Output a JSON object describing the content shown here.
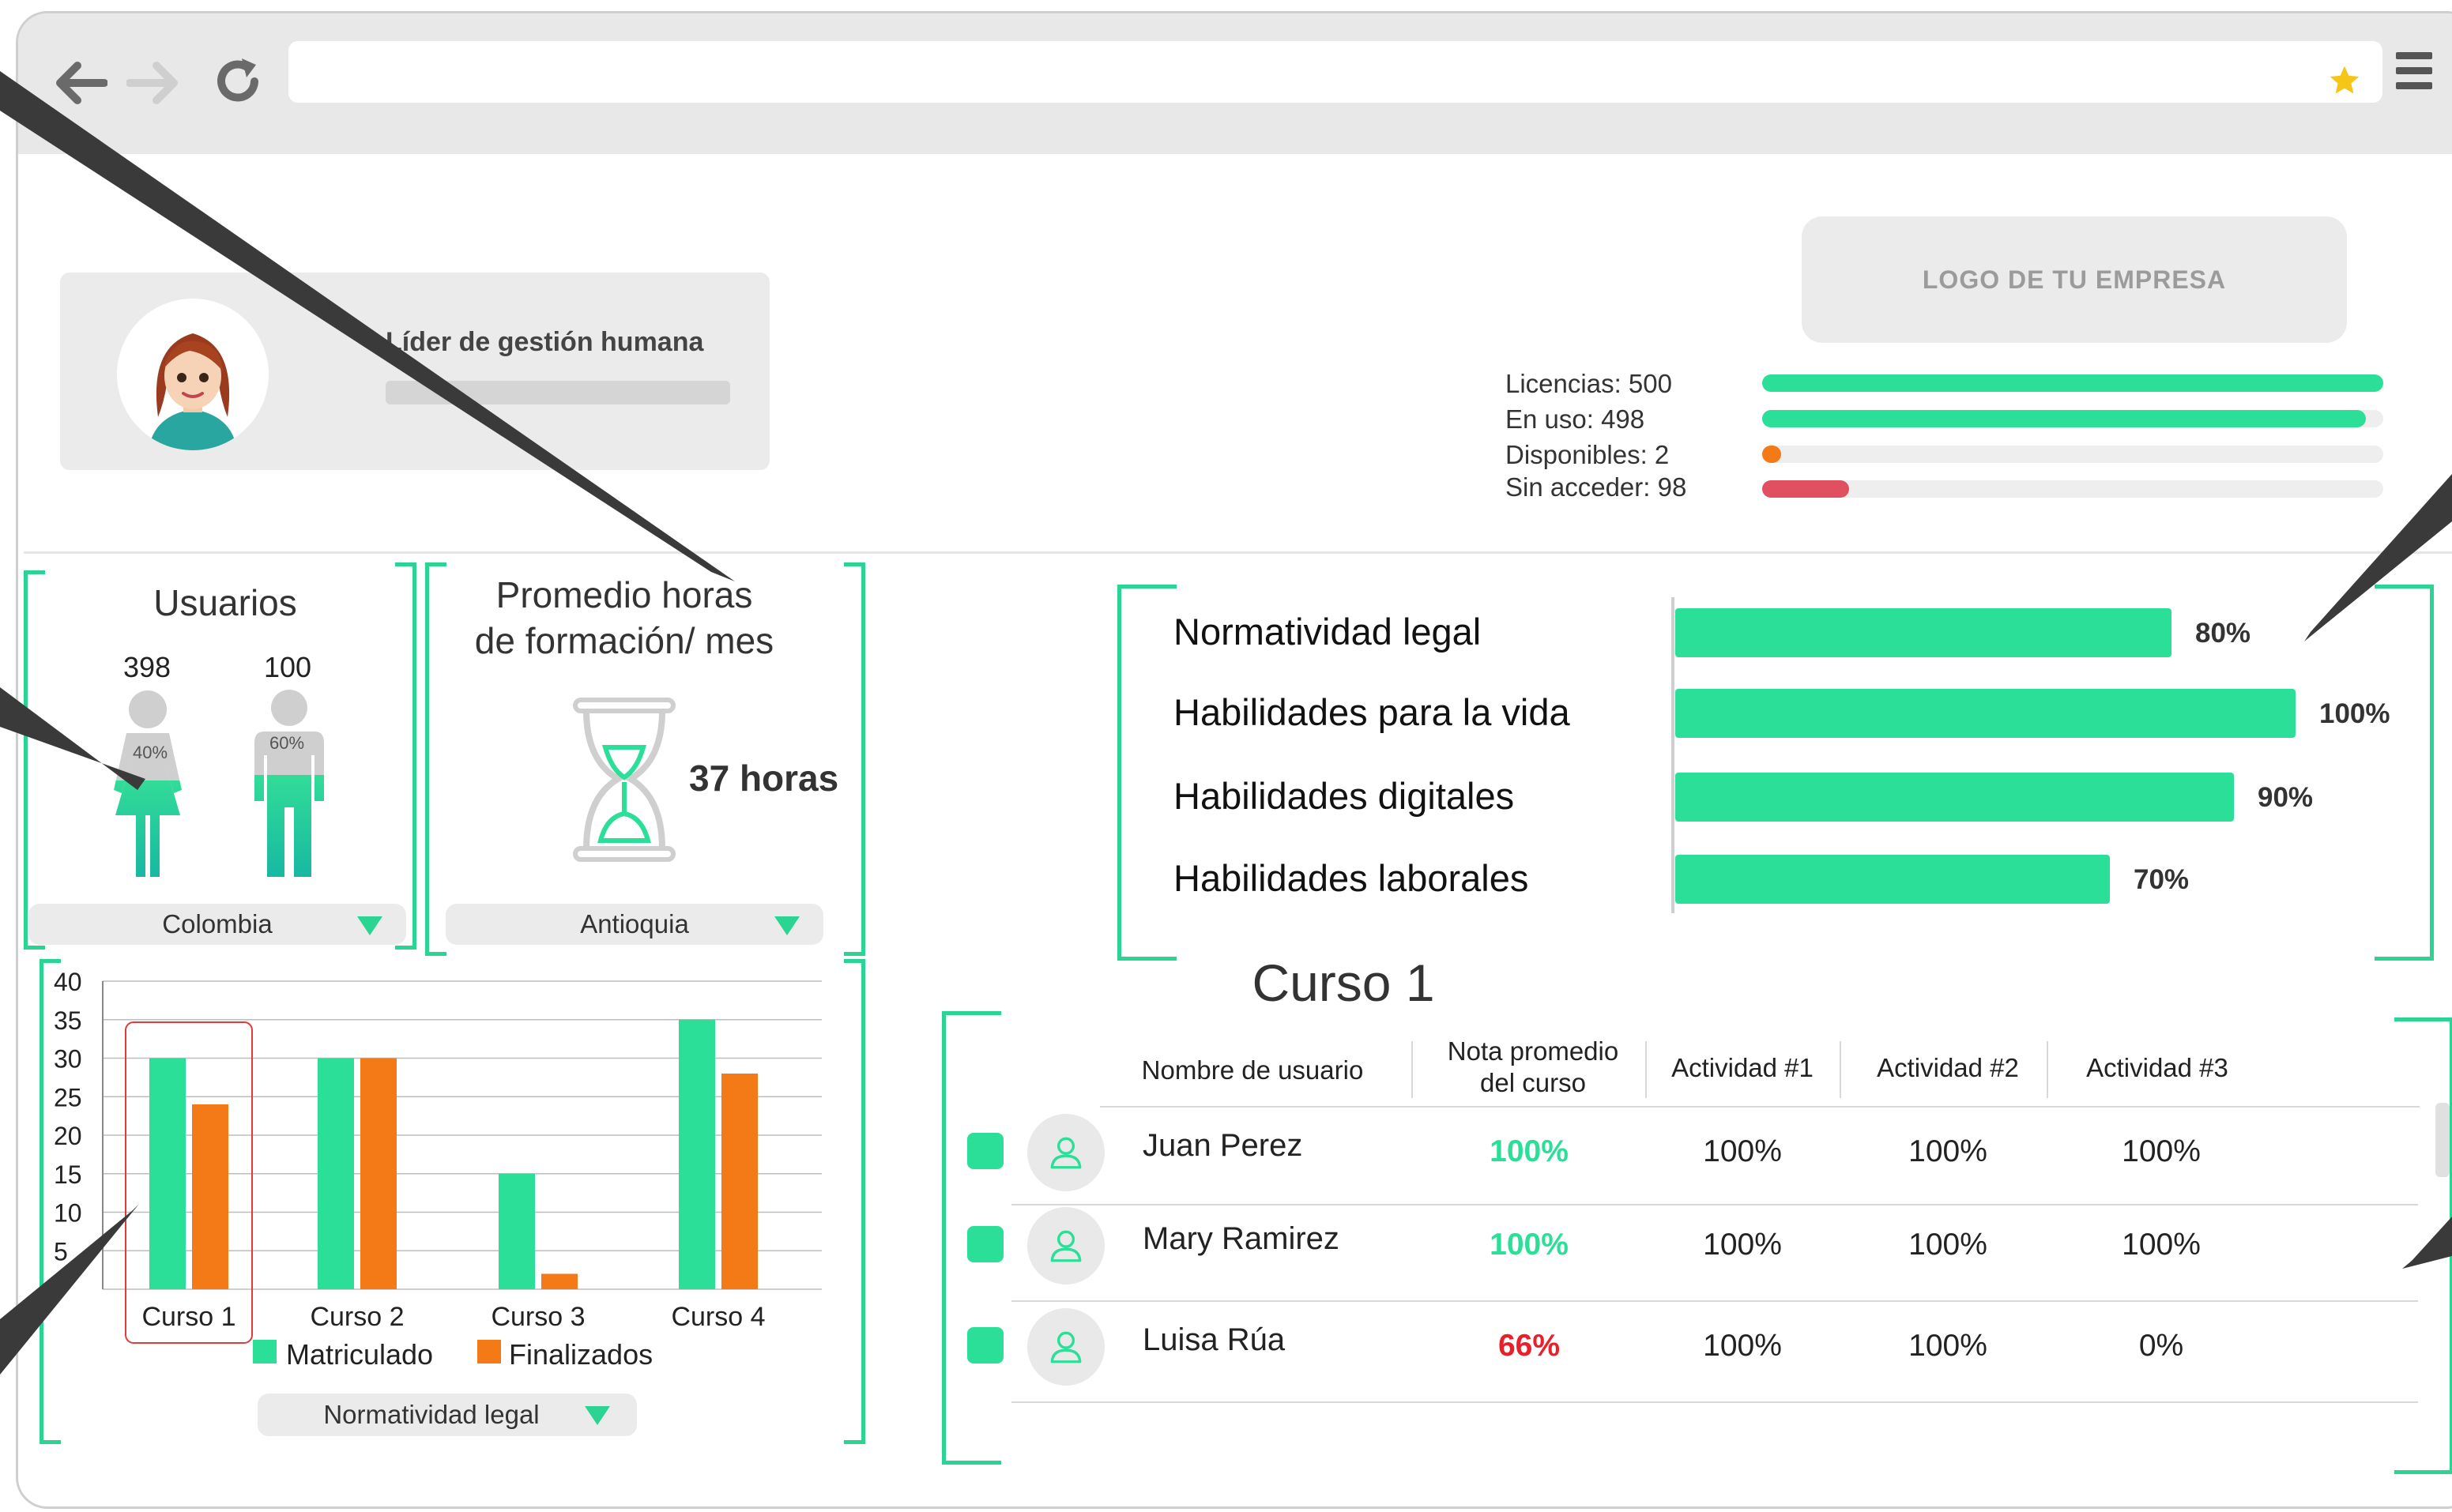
{
  "colors": {
    "accent_green": "#2cdf98",
    "bracket_green": "#2bd492",
    "orange": "#f47a17",
    "red": "#e05060",
    "dark_gray": "#3a3a3a"
  },
  "profile": {
    "role": "Líder de gestión humana",
    "avatar_icon": "woman-avatar-icon"
  },
  "logo": {
    "label": "LOGO DE TU EMPRESA"
  },
  "licenses": [
    {
      "label": "Licencias: 500",
      "fill": 1.0,
      "color": "#2cdf98"
    },
    {
      "label": "En uso: 498",
      "fill": 0.972,
      "color": "#2cdf98"
    },
    {
      "label": "Disponibles: 2",
      "fill": 0.03,
      "color": "#f47a17"
    },
    {
      "label": "Sin acceder: 98",
      "fill": 0.14,
      "color": "#e05060"
    }
  ],
  "usuarios": {
    "title": "Usuarios",
    "women": {
      "count": "398",
      "pct": "40%"
    },
    "men": {
      "count": "100",
      "pct": "60%"
    },
    "dropdown": "Colombia"
  },
  "promedio": {
    "title_line1": "Promedio horas",
    "title_line2": "de formación/ mes",
    "value": "37 horas",
    "dropdown": "Antioquia"
  },
  "chart_data": {
    "type": "bar",
    "categories": [
      "Curso 1",
      "Curso 2",
      "Curso 3",
      "Curso 4"
    ],
    "series": [
      {
        "name": "Matriculado",
        "values": [
          30,
          30,
          15,
          35
        ],
        "color": "#2cdf98"
      },
      {
        "name": "Finalizados",
        "values": [
          24,
          30,
          2,
          28
        ],
        "color": "#f47a17"
      }
    ],
    "yticks": [
      "40",
      "35",
      "30",
      "25",
      "20",
      "15",
      "10",
      "5"
    ],
    "ylim": [
      0,
      40
    ],
    "legend": "bottom",
    "grid": true,
    "highlighted_category": "Curso 1"
  },
  "chart_dropdown": "Normatividad legal",
  "skills": [
    {
      "label": "Normatividad legal",
      "pct": "80%",
      "value": 80
    },
    {
      "label": "Habilidades para la vida",
      "pct": "100%",
      "value": 100
    },
    {
      "label": "Habilidades digitales",
      "pct": "90%",
      "value": 90
    },
    {
      "label": "Habilidades laborales",
      "pct": "70%",
      "value": 70
    }
  ],
  "course": {
    "title": "Curso 1",
    "headers": {
      "user": "Nombre de usuario",
      "nota_line1": "Nota promedio",
      "nota_line2": "del curso",
      "act1": "Actividad #1",
      "act2": "Actividad #2",
      "act3": "Actividad #3"
    },
    "rows": [
      {
        "name": "Juan Perez",
        "nota": "100%",
        "nota_color": "#2cdf98",
        "a1": "100%",
        "a2": "100%",
        "a3": "100%"
      },
      {
        "name": "Mary Ramirez",
        "nota": "100%",
        "nota_color": "#2cdf98",
        "a1": "100%",
        "a2": "100%",
        "a3": "100%"
      },
      {
        "name": "Luisa Rúa",
        "nota": "66%",
        "nota_color": "#e8202a",
        "a1": "100%",
        "a2": "100%",
        "a3": "0%"
      }
    ]
  }
}
